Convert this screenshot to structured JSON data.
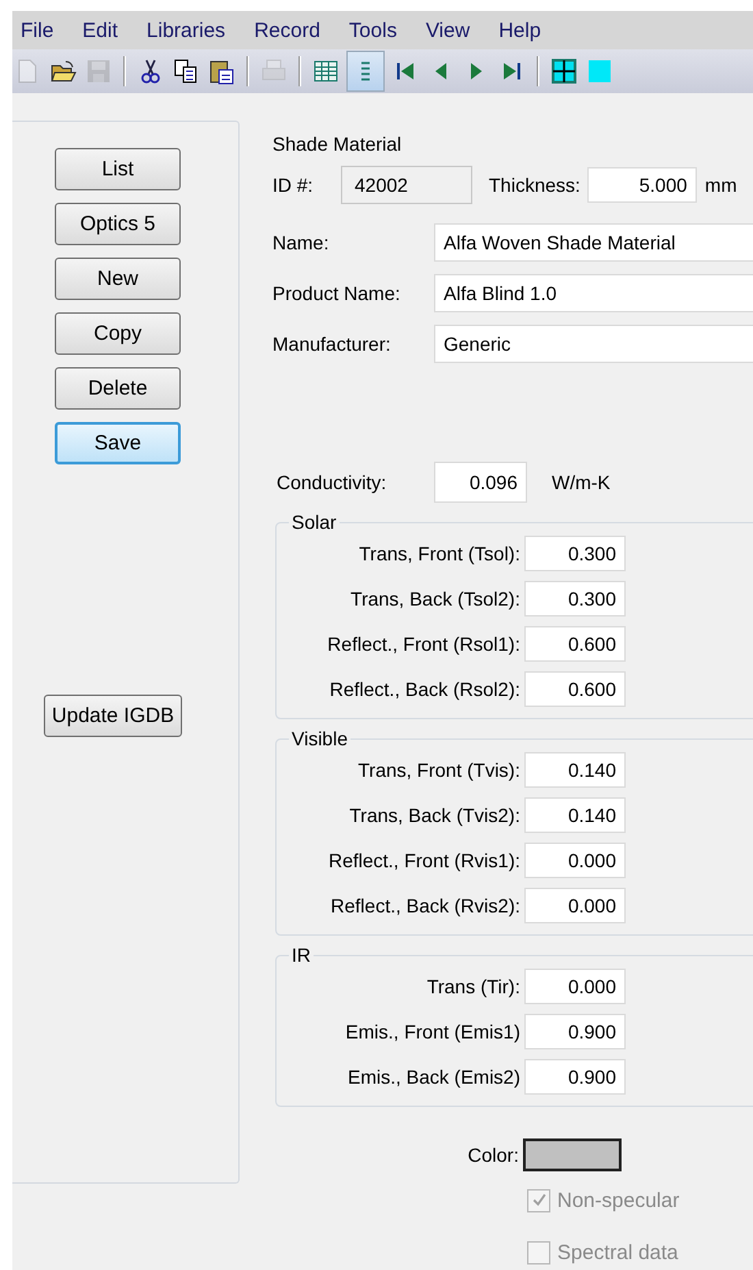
{
  "menu": [
    "File",
    "Edit",
    "Libraries",
    "Record",
    "Tools",
    "View",
    "Help"
  ],
  "toolbar": [
    {
      "kind": "new",
      "disabled": true,
      "selected": false
    },
    {
      "kind": "open",
      "disabled": false,
      "selected": false
    },
    {
      "kind": "save",
      "disabled": true,
      "selected": false
    },
    {
      "kind": "separator"
    },
    {
      "kind": "cut",
      "disabled": false,
      "selected": false
    },
    {
      "kind": "copy",
      "disabled": false,
      "selected": false
    },
    {
      "kind": "paste",
      "disabled": false,
      "selected": false
    },
    {
      "kind": "separator"
    },
    {
      "kind": "print",
      "disabled": true,
      "selected": false
    },
    {
      "kind": "separator"
    },
    {
      "kind": "grid",
      "disabled": false,
      "selected": false
    },
    {
      "kind": "list",
      "disabled": false,
      "selected": true
    },
    {
      "kind": "first",
      "disabled": false,
      "selected": false
    },
    {
      "kind": "prev",
      "disabled": false,
      "selected": false
    },
    {
      "kind": "next",
      "disabled": false,
      "selected": false
    },
    {
      "kind": "last",
      "disabled": false,
      "selected": false
    },
    {
      "kind": "separator"
    },
    {
      "kind": "cross",
      "disabled": false,
      "selected": false
    },
    {
      "kind": "swatch",
      "disabled": false,
      "selected": false
    }
  ],
  "buttons": [
    {
      "label": "List",
      "default": false
    },
    {
      "label": "Optics 5",
      "default": false
    },
    {
      "label": "New",
      "default": false
    },
    {
      "label": "Copy",
      "default": false
    },
    {
      "label": "Delete",
      "default": false
    },
    {
      "label": "Save",
      "default": true
    }
  ],
  "update_button": "Update IGDB",
  "form": {
    "title": "Shade Material",
    "id_label": "ID #:",
    "id_value": "42002",
    "thickness_label": "Thickness:",
    "thickness_value": "5.000",
    "thickness_unit": "mm",
    "fields": [
      {
        "label": "Name:",
        "value": "Alfa Woven Shade Material"
      },
      {
        "label": "Product Name:",
        "value": "Alfa Blind 1.0"
      },
      {
        "label": "Manufacturer:",
        "value": "Generic"
      }
    ],
    "conductivity": {
      "label": "Conductivity:",
      "value": "0.096",
      "unit": "W/m-K"
    }
  },
  "groups": [
    {
      "title": "Solar",
      "rows": [
        {
          "label": "Trans, Front  (Tsol):",
          "value": "0.300"
        },
        {
          "label": "Trans, Back (Tsol2):",
          "value": "0.300"
        },
        {
          "label": "Reflect., Front (Rsol1):",
          "value": "0.600"
        },
        {
          "label": "Reflect., Back (Rsol2):",
          "value": "0.600"
        }
      ]
    },
    {
      "title": "Visible",
      "rows": [
        {
          "label": "Trans, Front (Tvis):",
          "value": "0.140"
        },
        {
          "label": "Trans, Back (Tvis2):",
          "value": "0.140"
        },
        {
          "label": "Reflect., Front (Rvis1):",
          "value": "0.000"
        },
        {
          "label": "Reflect., Back (Rvis2):",
          "value": "0.000"
        }
      ]
    },
    {
      "title": "IR",
      "rows": [
        {
          "label": "Trans (Tir):",
          "value": "0.000"
        },
        {
          "label": "Emis., Front (Emis1)",
          "value": "0.900"
        },
        {
          "label": "Emis., Back (Emis2)",
          "value": "0.900"
        }
      ]
    }
  ],
  "color_label": "Color:",
  "color": "#c0c0c0",
  "checkboxes": [
    {
      "label": "Non-specular",
      "checked": true,
      "disabled": true
    },
    {
      "label": "Spectral data",
      "checked": false,
      "disabled": true
    }
  ]
}
